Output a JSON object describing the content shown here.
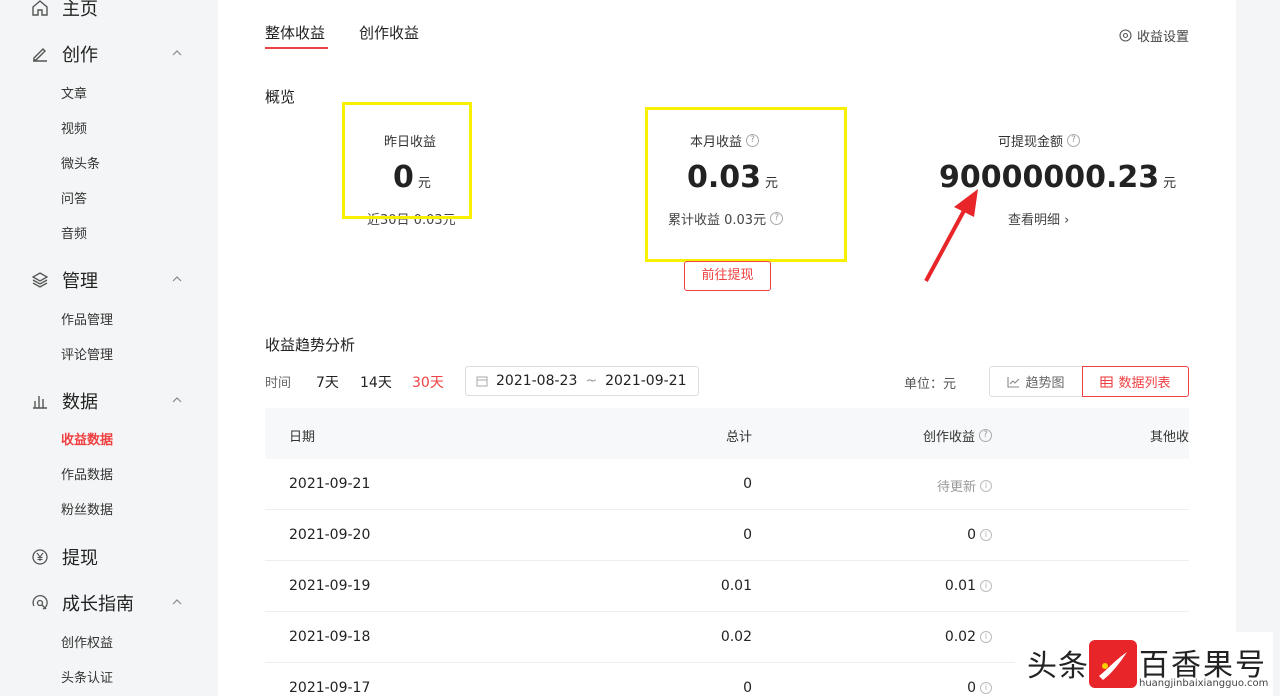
{
  "sidebar": {
    "home": "主页",
    "create": {
      "label": "创作",
      "items": [
        "文章",
        "视频",
        "微头条",
        "问答",
        "音频"
      ]
    },
    "manage": {
      "label": "管理",
      "items": [
        "作品管理",
        "评论管理"
      ]
    },
    "data": {
      "label": "数据",
      "items": [
        "收益数据",
        "作品数据",
        "粉丝数据"
      ],
      "active_index": 0
    },
    "withdraw": "提现",
    "growth": {
      "label": "成长指南",
      "items": [
        "创作权益",
        "头条认证"
      ]
    }
  },
  "tabs": [
    "整体收益",
    "创作收益"
  ],
  "active_tab": 0,
  "settings_label": "收益设置",
  "overview": {
    "title": "概览",
    "yesterday": {
      "label": "昨日收益",
      "value": "0",
      "unit": "元",
      "sub": "近30日 0.03元"
    },
    "month": {
      "label": "本月收益",
      "value": "0.03",
      "unit": "元",
      "sub": "累计收益 0.03元"
    },
    "withdrawable": {
      "label": "可提现金额",
      "value": "90000000.23",
      "unit": "元",
      "sub": "查看明细 ›"
    },
    "withdraw_button": "前往提现"
  },
  "trend": {
    "title": "收益趋势分析",
    "time_label": "时间",
    "ranges": [
      "7天",
      "14天",
      "30天"
    ],
    "active_range": 2,
    "date_start": "2021-08-23",
    "date_sep": "~",
    "date_end": "2021-09-21",
    "unit_label": "单位：元",
    "chart_button": "趋势图",
    "list_button": "数据列表"
  },
  "table": {
    "headers": [
      "日期",
      "总计",
      "创作收益",
      "其他收"
    ],
    "rows": [
      {
        "date": "2021-09-21",
        "total": "0",
        "creation": "待更新"
      },
      {
        "date": "2021-09-20",
        "total": "0",
        "creation": "0"
      },
      {
        "date": "2021-09-19",
        "total": "0.01",
        "creation": "0.01"
      },
      {
        "date": "2021-09-18",
        "total": "0.02",
        "creation": "0.02"
      },
      {
        "date": "2021-09-17",
        "total": "0",
        "creation": "0"
      }
    ]
  },
  "watermark": {
    "left": "头条",
    "right": "百香果号",
    "url": "huangjinbaixiangguo.com"
  },
  "colors": {
    "accent": "#f04142",
    "highlight": "#f7f000"
  }
}
